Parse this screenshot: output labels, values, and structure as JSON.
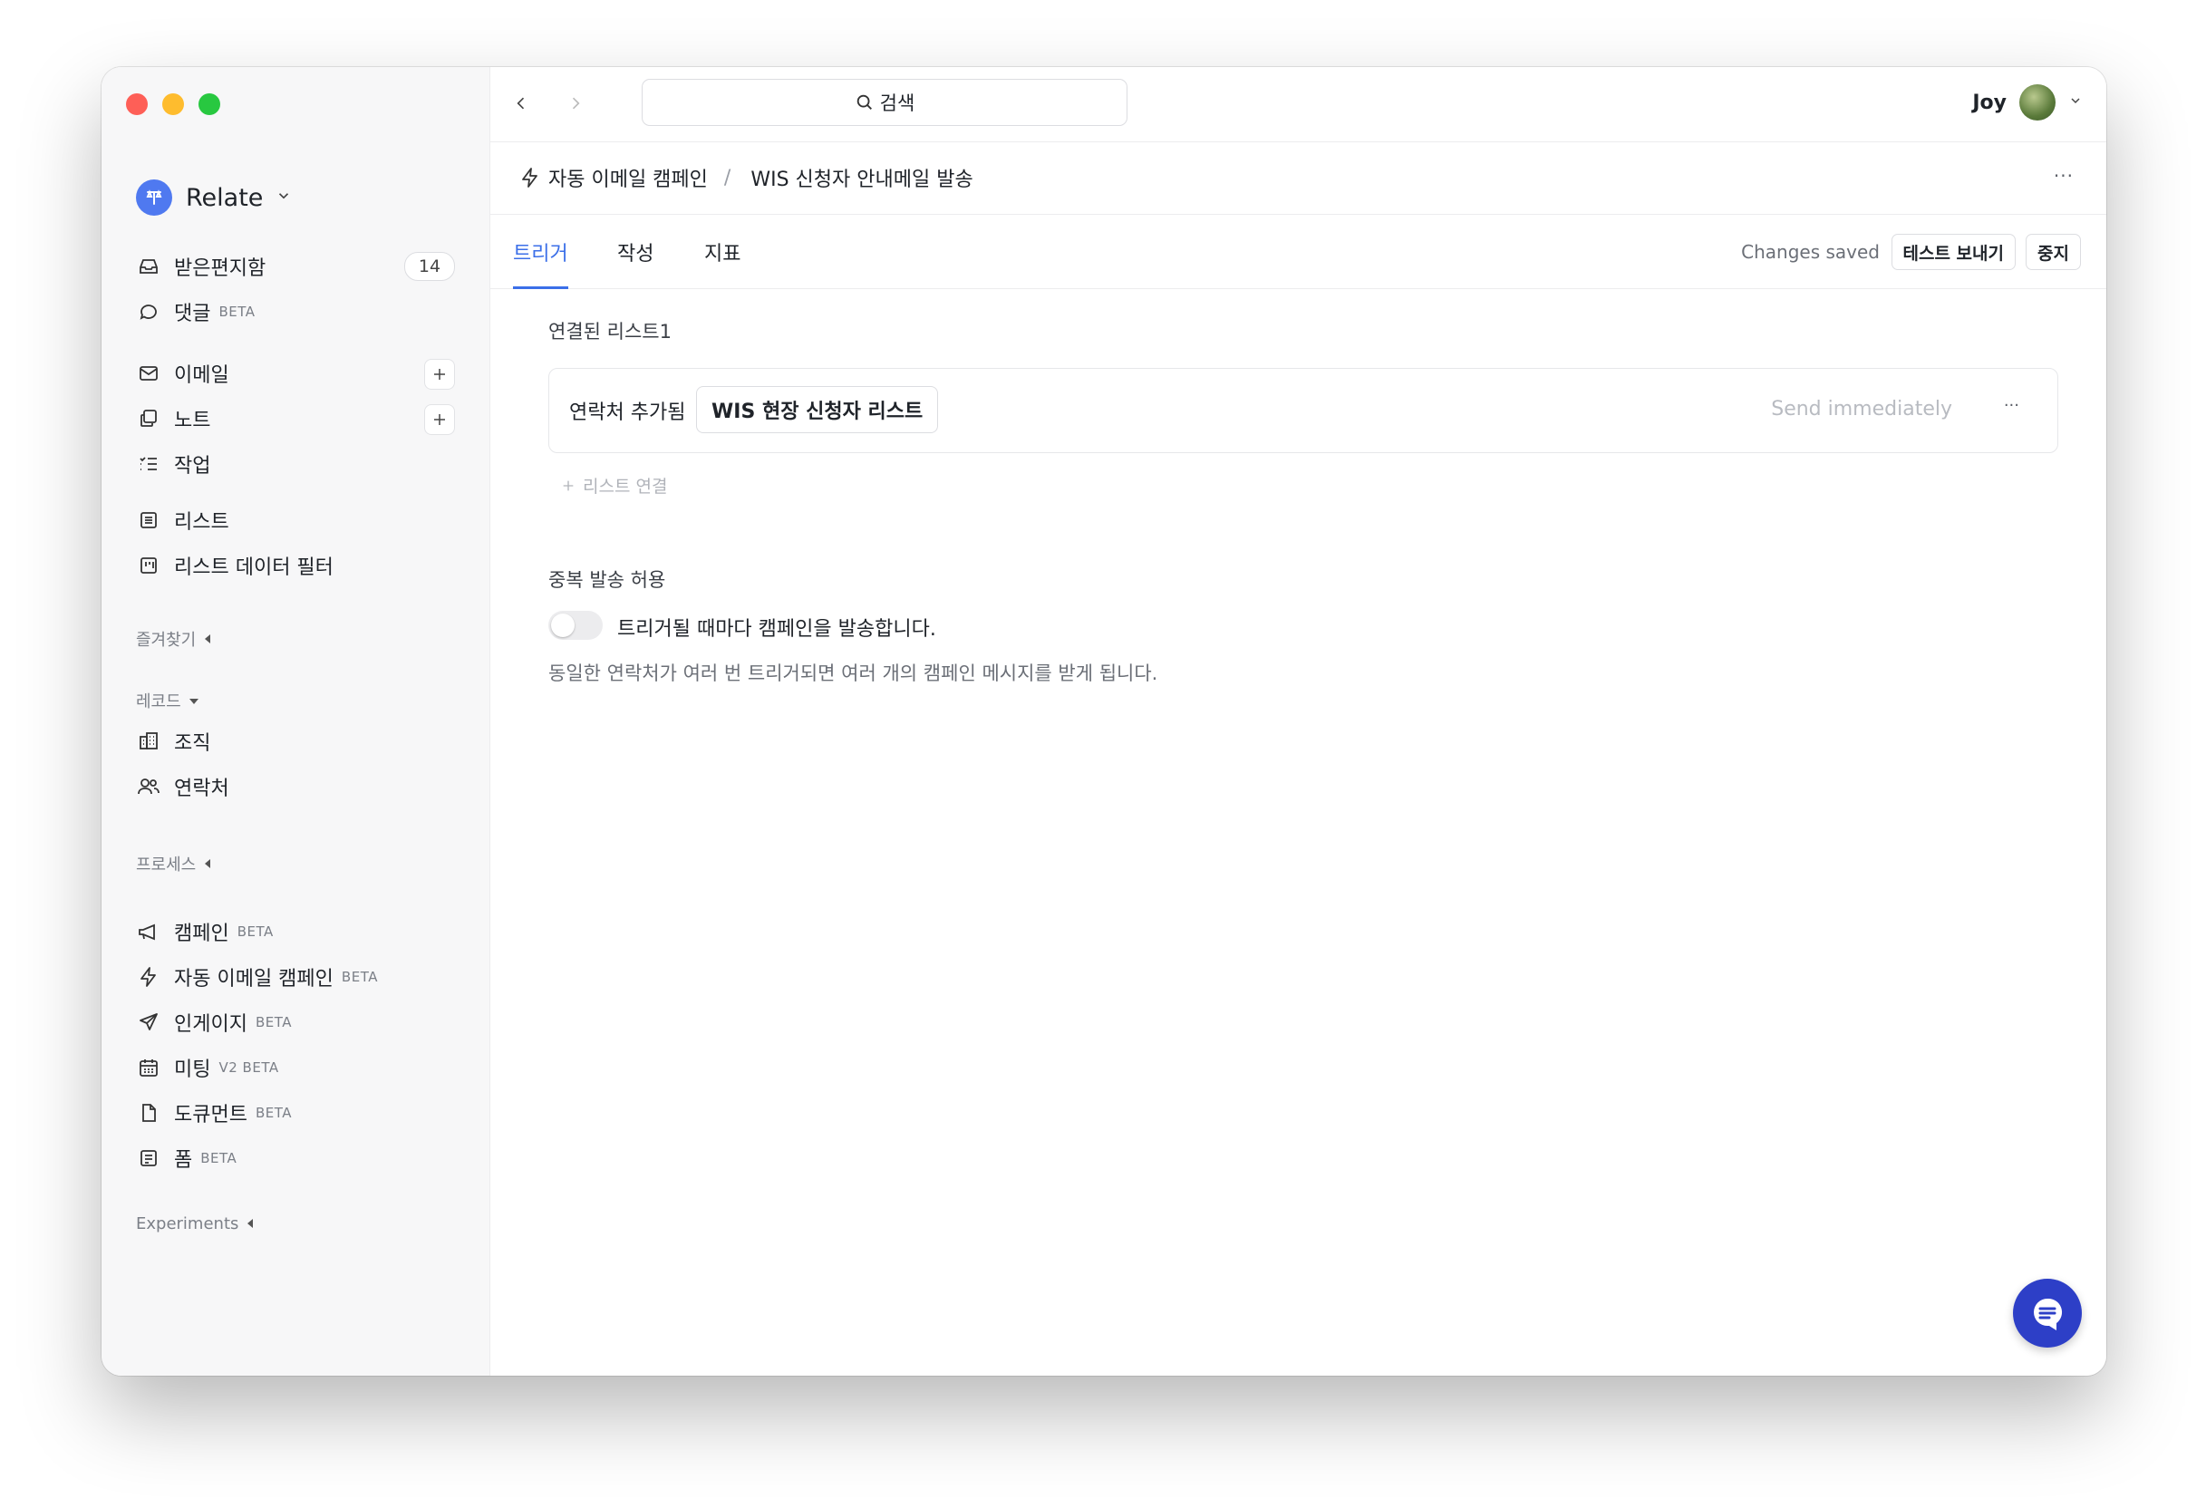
{
  "workspace": {
    "name": "Relate"
  },
  "sidebar": {
    "inbox": {
      "label": "받은편지함",
      "count": "14"
    },
    "comments": {
      "label": "댓글",
      "badge": "BETA"
    },
    "email": {
      "label": "이메일"
    },
    "notes": {
      "label": "노트"
    },
    "tasks": {
      "label": "작업"
    },
    "lists": {
      "label": "리스트"
    },
    "list_filters": {
      "label": "리스트 데이터 필터"
    },
    "favorites_header": "즐겨찾기",
    "records_header": "레코드",
    "org": {
      "label": "조직"
    },
    "contacts": {
      "label": "연락처"
    },
    "process_header": "프로세스",
    "campaign": {
      "label": "캠페인",
      "badge": "BETA"
    },
    "auto_email": {
      "label": "자동 이메일 캠페인",
      "badge": "BETA"
    },
    "engage": {
      "label": "인게이지",
      "badge": "BETA"
    },
    "meeting": {
      "label": "미팅",
      "badge": "V2 BETA"
    },
    "document": {
      "label": "도큐먼트",
      "badge": "BETA"
    },
    "form": {
      "label": "폼",
      "badge": "BETA"
    },
    "experiments_header": "Experiments"
  },
  "topbar": {
    "search_label": "검색",
    "user_name": "Joy"
  },
  "breadcrumb": {
    "parent": "자동 이메일 캠페인",
    "separator": "/",
    "current": "WIS 신청자 안내메일 발송",
    "more": "···"
  },
  "tabs": {
    "trigger": "트리거",
    "compose": "작성",
    "metrics": "지표"
  },
  "status": {
    "saved": "Changes saved"
  },
  "actions": {
    "send_test": "테스트 보내기",
    "stop": "중지"
  },
  "trigger": {
    "section_title": "연결된 리스트1",
    "event_label": "연락처 추가됨",
    "list_name": "WIS 현장 신청자 리스트",
    "timing": "Send immediately",
    "more": "···",
    "add_list": "리스트 연결"
  },
  "duplicate": {
    "section_title": "중복 발송 허용",
    "toggle_label": "트리거될 때마다 캠페인을 발송합니다.",
    "hint": "동일한 연락처가 여러 번 트리거되면 여러 개의 캠페인 메시지를 받게 됩니다.",
    "enabled": false
  },
  "colors": {
    "accent": "#3b6fe8",
    "fab": "#2d3fc7"
  }
}
